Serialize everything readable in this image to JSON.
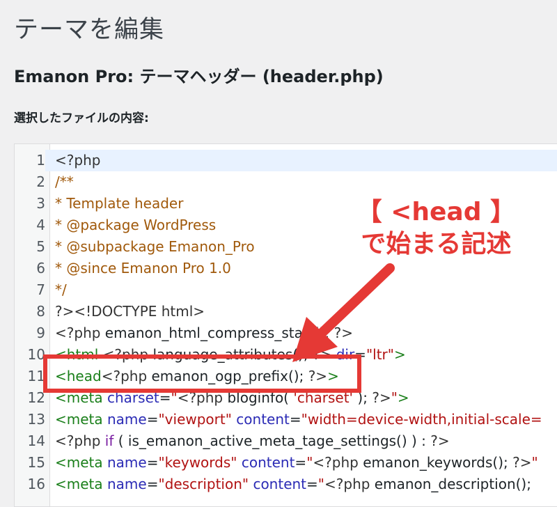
{
  "page": {
    "title": "テーマを編集",
    "file_title": "Emanon Pro: テーマヘッダー (header.php)",
    "content_label": "選択したファイルの内容:"
  },
  "editor": {
    "lines": [
      {
        "n": "1",
        "segments": [
          {
            "c": "t-meta",
            "t": "<?php"
          }
        ]
      },
      {
        "n": "2",
        "segments": [
          {
            "c": "t-comment",
            "t": "/**"
          }
        ]
      },
      {
        "n": "3",
        "segments": [
          {
            "c": "t-comment",
            "t": "* Template header"
          }
        ]
      },
      {
        "n": "4",
        "segments": [
          {
            "c": "t-comment",
            "t": "* @package WordPress"
          }
        ]
      },
      {
        "n": "5",
        "segments": [
          {
            "c": "t-comment",
            "t": "* @subpackage Emanon_Pro"
          }
        ]
      },
      {
        "n": "6",
        "segments": [
          {
            "c": "t-comment",
            "t": "* @since Emanon Pro 1.0"
          }
        ]
      },
      {
        "n": "7",
        "segments": [
          {
            "c": "t-comment",
            "t": "*/"
          }
        ]
      },
      {
        "n": "8",
        "segments": [
          {
            "c": "t-meta",
            "t": "?><!DOCTYPE html>"
          }
        ]
      },
      {
        "n": "9",
        "segments": [
          {
            "c": "t-meta",
            "t": "<?php "
          },
          {
            "c": "t-plain",
            "t": "emanon_html_compress_start(); "
          },
          {
            "c": "t-meta",
            "t": "?>"
          }
        ]
      },
      {
        "n": "10",
        "segments": [
          {
            "c": "t-tag",
            "t": "<html "
          },
          {
            "c": "t-meta",
            "t": "<?php "
          },
          {
            "c": "t-plain",
            "t": "language_attributes(); "
          },
          {
            "c": "t-meta",
            "t": "?> "
          },
          {
            "c": "t-attr",
            "t": "dir"
          },
          {
            "c": "t-plain",
            "t": "="
          },
          {
            "c": "t-str",
            "t": "\"ltr\""
          },
          {
            "c": "t-tag",
            "t": ">"
          }
        ]
      },
      {
        "n": "11",
        "segments": [
          {
            "c": "t-tag",
            "t": "<head"
          },
          {
            "c": "t-meta",
            "t": "<?php "
          },
          {
            "c": "t-plain",
            "t": "emanon_ogp_prefix(); "
          },
          {
            "c": "t-meta",
            "t": "?>"
          },
          {
            "c": "t-tag",
            "t": ">"
          }
        ]
      },
      {
        "n": "12",
        "segments": [
          {
            "c": "t-tag",
            "t": "<meta "
          },
          {
            "c": "t-attr",
            "t": "charset"
          },
          {
            "c": "t-plain",
            "t": "="
          },
          {
            "c": "t-str",
            "t": "\""
          },
          {
            "c": "t-meta",
            "t": "<?php "
          },
          {
            "c": "t-plain",
            "t": "bloginfo( "
          },
          {
            "c": "t-str",
            "t": "'charset'"
          },
          {
            "c": "t-plain",
            "t": " ); "
          },
          {
            "c": "t-meta",
            "t": "?>"
          },
          {
            "c": "t-str",
            "t": "\""
          },
          {
            "c": "t-tag",
            "t": ">"
          }
        ]
      },
      {
        "n": "13",
        "segments": [
          {
            "c": "t-tag",
            "t": "<meta "
          },
          {
            "c": "t-attr",
            "t": "name"
          },
          {
            "c": "t-plain",
            "t": "="
          },
          {
            "c": "t-str",
            "t": "\"viewport\""
          },
          {
            "c": "t-plain",
            "t": " "
          },
          {
            "c": "t-attr",
            "t": "content"
          },
          {
            "c": "t-plain",
            "t": "="
          },
          {
            "c": "t-str",
            "t": "\"width=device-width,initial-scale="
          }
        ]
      },
      {
        "n": "14",
        "segments": [
          {
            "c": "t-meta",
            "t": "<?php "
          },
          {
            "c": "t-kw",
            "t": "if"
          },
          {
            "c": "t-plain",
            "t": " ( is_emanon_active_meta_tage_settings() ) : "
          },
          {
            "c": "t-meta",
            "t": "?>"
          }
        ]
      },
      {
        "n": "15",
        "segments": [
          {
            "c": "t-tag",
            "t": "<meta "
          },
          {
            "c": "t-attr",
            "t": "name"
          },
          {
            "c": "t-plain",
            "t": "="
          },
          {
            "c": "t-str",
            "t": "\"keywords\""
          },
          {
            "c": "t-plain",
            "t": " "
          },
          {
            "c": "t-attr",
            "t": "content"
          },
          {
            "c": "t-plain",
            "t": "="
          },
          {
            "c": "t-str",
            "t": "\""
          },
          {
            "c": "t-meta",
            "t": "<?php "
          },
          {
            "c": "t-plain",
            "t": "emanon_keywords(); "
          },
          {
            "c": "t-meta",
            "t": "?>"
          },
          {
            "c": "t-str",
            "t": "\""
          }
        ]
      },
      {
        "n": "16",
        "segments": [
          {
            "c": "t-tag",
            "t": "<meta "
          },
          {
            "c": "t-attr",
            "t": "name"
          },
          {
            "c": "t-plain",
            "t": "="
          },
          {
            "c": "t-str",
            "t": "\"description\""
          },
          {
            "c": "t-plain",
            "t": " "
          },
          {
            "c": "t-attr",
            "t": "content"
          },
          {
            "c": "t-plain",
            "t": "="
          },
          {
            "c": "t-str",
            "t": "\""
          },
          {
            "c": "t-meta",
            "t": "<?php "
          },
          {
            "c": "t-plain",
            "t": "emanon_description(); "
          }
        ]
      }
    ]
  },
  "annotation": {
    "line1": "【 <head 】",
    "line2": "で始まる記述",
    "color": "#e53935"
  }
}
